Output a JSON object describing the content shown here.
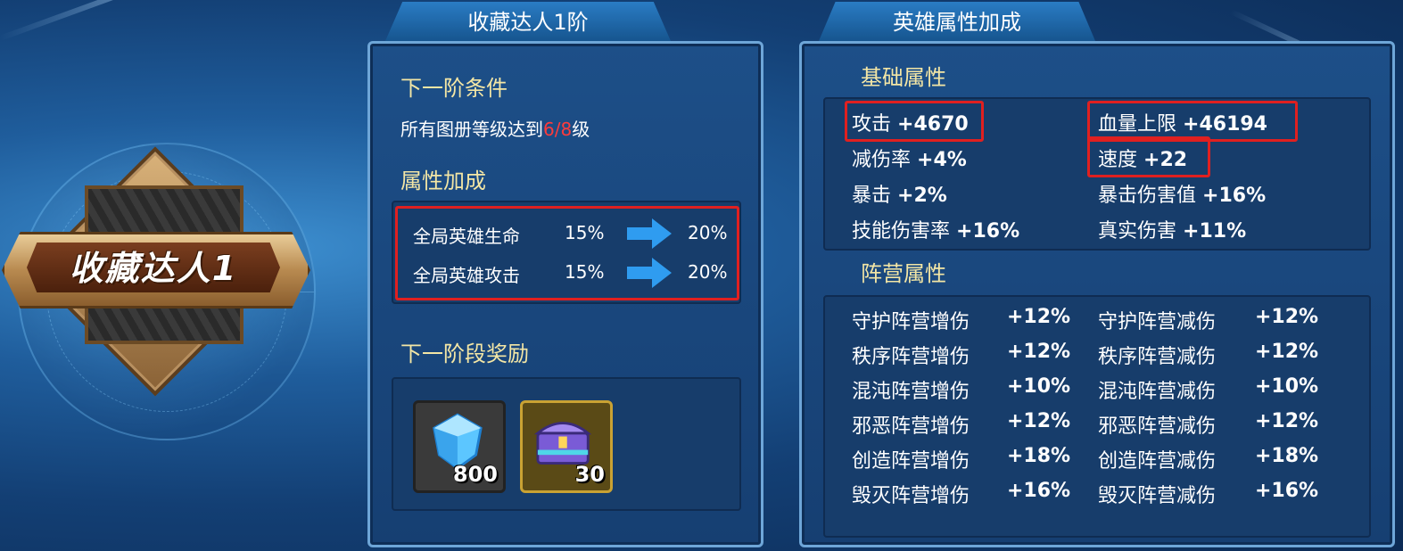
{
  "badge": {
    "title": "收藏达人1"
  },
  "middle": {
    "tab_title": "收藏达人1阶",
    "next_condition_header": "下一阶条件",
    "condition_prefix": "所有图册等级达到",
    "condition_progress": "6/8",
    "condition_suffix": "级",
    "bonus_header": "属性加成",
    "bonuses": [
      {
        "label": "全局英雄生命",
        "from": "15%",
        "to": "20%"
      },
      {
        "label": "全局英雄攻击",
        "from": "15%",
        "to": "20%"
      }
    ],
    "reward_header": "下一阶段奖励",
    "rewards": [
      {
        "icon": "diamond-gem-icon",
        "qty": "800"
      },
      {
        "icon": "treasure-chest-icon",
        "qty": "30"
      }
    ]
  },
  "right": {
    "tab_title": "英雄属性加成",
    "base_header": "基础属性",
    "base_stats": [
      {
        "label": "攻击",
        "value": "+4670"
      },
      {
        "label": "血量上限",
        "value": "+46194"
      },
      {
        "label": "减伤率",
        "value": "+4%"
      },
      {
        "label": "速度",
        "value": "+22"
      },
      {
        "label": "暴击",
        "value": "+2%"
      },
      {
        "label": "暴击伤害值",
        "value": "+16%"
      },
      {
        "label": "技能伤害率",
        "value": "+16%"
      },
      {
        "label": "真实伤害",
        "value": "+11%"
      }
    ],
    "camp_header": "阵营属性",
    "camp_stats": [
      {
        "label": "守护阵营增伤",
        "value": "+12%"
      },
      {
        "label": "守护阵营减伤",
        "value": "+12%"
      },
      {
        "label": "秩序阵营增伤",
        "value": "+12%"
      },
      {
        "label": "秩序阵营减伤",
        "value": "+12%"
      },
      {
        "label": "混沌阵营增伤",
        "value": "+10%"
      },
      {
        "label": "混沌阵营减伤",
        "value": "+10%"
      },
      {
        "label": "邪恶阵营增伤",
        "value": "+12%"
      },
      {
        "label": "邪恶阵营减伤",
        "value": "+12%"
      },
      {
        "label": "创造阵营增伤",
        "value": "+18%"
      },
      {
        "label": "创造阵营减伤",
        "value": "+18%"
      },
      {
        "label": "毁灭阵营增伤",
        "value": "+16%"
      },
      {
        "label": "毁灭阵营减伤",
        "value": "+16%"
      }
    ]
  },
  "colors": {
    "highlight": "#e02020",
    "section": "#f3e6a5",
    "progress": "#ff3b3b",
    "arrow": "#2f9cf0"
  }
}
